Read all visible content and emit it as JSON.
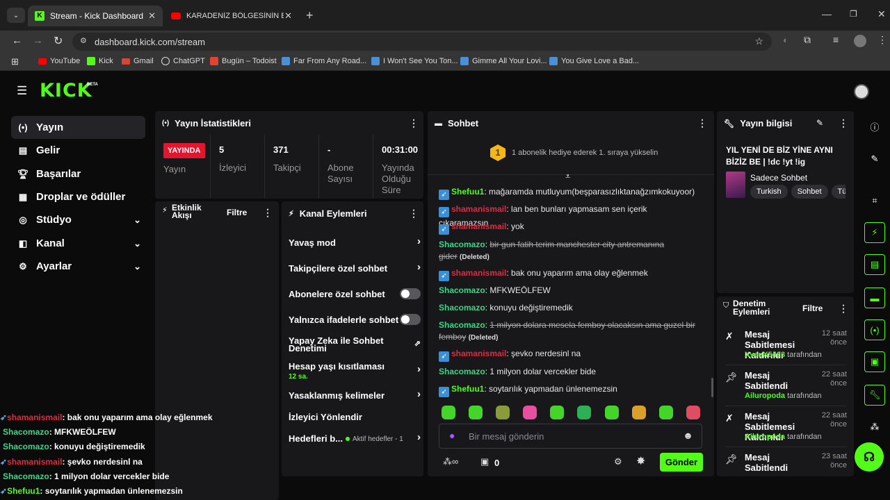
{
  "browser": {
    "tabs": [
      {
        "title": "Stream - Kick Dashboard",
        "active": true
      },
      {
        "title": "KARADENİZ BÖLGESİNİN EN Ç",
        "active": false
      }
    ],
    "url": "dashboard.kick.com/stream",
    "bookmarks": [
      "YouTube",
      "Kick",
      "Gmail",
      "ChatGPT",
      "Bugün – Todoist",
      "Far From Any Road...",
      "I Won't See You Ton...",
      "Gimme All Your Lovi...",
      "You Give Love a Bad..."
    ]
  },
  "brand": {
    "logo": "KICK",
    "beta": "BETA",
    "accent": "#53fc18"
  },
  "sidebar": {
    "items": [
      {
        "label": "Yayın",
        "icon": "broadcast-icon",
        "active": true
      },
      {
        "label": "Gelir",
        "icon": "money-icon"
      },
      {
        "label": "Başarılar",
        "icon": "trophy-icon"
      },
      {
        "label": "Droplar ve ödüller",
        "icon": "gift-icon"
      },
      {
        "label": "Stüdyo",
        "icon": "studio-icon",
        "expandable": true
      },
      {
        "label": "Kanal",
        "icon": "channel-icon",
        "expandable": true
      },
      {
        "label": "Ayarlar",
        "icon": "gear-icon",
        "expandable": true
      }
    ]
  },
  "stats": {
    "title": "Yayın İstatistikleri",
    "live_badge": "YAYINDA",
    "items": [
      {
        "label": "Yayın"
      },
      {
        "value": "5",
        "label": "İzleyici"
      },
      {
        "value": "371",
        "label": "Takipçi"
      },
      {
        "value": "-",
        "label": "Abone Sayısı"
      },
      {
        "value": "00:31:00",
        "label": "Yayında Olduğu Süre"
      }
    ]
  },
  "activity": {
    "title": "Etkinlik Akışı",
    "filter": "Filtre"
  },
  "channel_actions": {
    "title": "Kanal Eylemleri",
    "items": [
      {
        "label": "Yavaş mod",
        "control": "arrow"
      },
      {
        "label": "Takipçilere özel sohbet",
        "control": "arrow"
      },
      {
        "label": "Abonelere özel sohbet",
        "control": "toggle"
      },
      {
        "label": "Yalnızca ifadelerle sohbet",
        "control": "toggle"
      },
      {
        "label": "Yapay Zeka ile Sohbet Denetimi",
        "control": "external"
      },
      {
        "label": "Hesap yaşı kısıtlaması",
        "sub": "12 sa.",
        "control": "arrow"
      },
      {
        "label": "Yasaklanmış kelimeler",
        "control": "arrow"
      },
      {
        "label": "İzleyici Yönlendir",
        "control": "none"
      },
      {
        "label": "Hedefleri b...",
        "sub": "Aktif hedefler - 1",
        "control": "arrow"
      }
    ]
  },
  "chat": {
    "title": "Sohbet",
    "sub_goal": "1 abonelik hediye ederek 1. sıraya yükselin",
    "sub_goal_rank": "1",
    "placeholder": "Bir mesaj gönderin",
    "send": "Gönder",
    "points": "0",
    "messages": [
      {
        "user": "Shefuu1",
        "text": "mağaramda mutluyum(beşparasızlıktanağzımkokuyoor)"
      },
      {
        "user": "shamanismail",
        "text": "lan ben bunları yapmasam sen içerik çıkaramazsın"
      },
      {
        "user": "shamanismail",
        "text": "yok"
      },
      {
        "user": "Shacomazo",
        "text_a": "bir gun fatih terim manchester city antremanına",
        "text_b": "gider",
        "deleted": "(Deleted)"
      },
      {
        "user": "shamanismail",
        "text": "bak onu yaparım ama olay eğlenmek"
      },
      {
        "user": "Shacomazo",
        "text": "MFKWEÖLFEW"
      },
      {
        "user": "Shacomazo",
        "text": "konuyu değiştiremedik"
      },
      {
        "user": "Shacomazo",
        "text_a": "1 milyon dolara mesela femboy olacaksın ama guzel bir",
        "text_b": "femboy",
        "deleted": "(Deleted)"
      },
      {
        "user": "shamanismail",
        "text": "şevko nerdesinl na"
      },
      {
        "user": "Shacomazo",
        "text": "1 milyon dolar vercekler bide"
      },
      {
        "user": "Shefuu1",
        "text": "soytarılık yapmadan ünlenemezsin"
      }
    ]
  },
  "stream_info": {
    "title": "Yayın bilgisi",
    "stream_title": "YIL YENİ DE BİZ YİNE AYNI BİZİZ BE | !dc !yt !ig",
    "category": "Sadece Sohbet",
    "tags": [
      "Turkish",
      "Sohbet",
      "Türk"
    ]
  },
  "moderation": {
    "title": "Denetim Eylemleri",
    "filter": "Filtre",
    "by_suffix": "tarafından",
    "items": [
      {
        "action": "Mesaj Sabitlemesi Kaldırıldı",
        "time": "12 saat önce",
        "user": "XveuX5423",
        "icon": "unpin-icon"
      },
      {
        "action": "Mesaj Sabitlendi",
        "time": "22 saat önce",
        "user": "Ailuropoda",
        "icon": "pin-icon"
      },
      {
        "action": "Mesaj Sabitlemesi Kaldırıldı",
        "time": "22 saat önce",
        "user": "Ailuropoda",
        "icon": "unpin-icon"
      },
      {
        "action": "Mesaj Sabitlendi",
        "time": "23 saat önce",
        "user": "",
        "icon": "pin-icon"
      }
    ]
  },
  "overlay_chat": [
    {
      "user": "shamanismail",
      "text": "bak onu yaparım ama olay eğlenmek"
    },
    {
      "user": "Shacomazo",
      "text": "MFKWEÖLFEW"
    },
    {
      "user": "Shacomazo",
      "text": "konuyu değiştiremedik"
    },
    {
      "user": "shamanismail",
      "text": "şevko nerdesinl na"
    },
    {
      "user": "Shacomazo",
      "text": "1 milyon dolar vercekler bide"
    },
    {
      "user": "Shefuu1",
      "text": "soytarılık yapmadan ünlenemezsin"
    }
  ]
}
